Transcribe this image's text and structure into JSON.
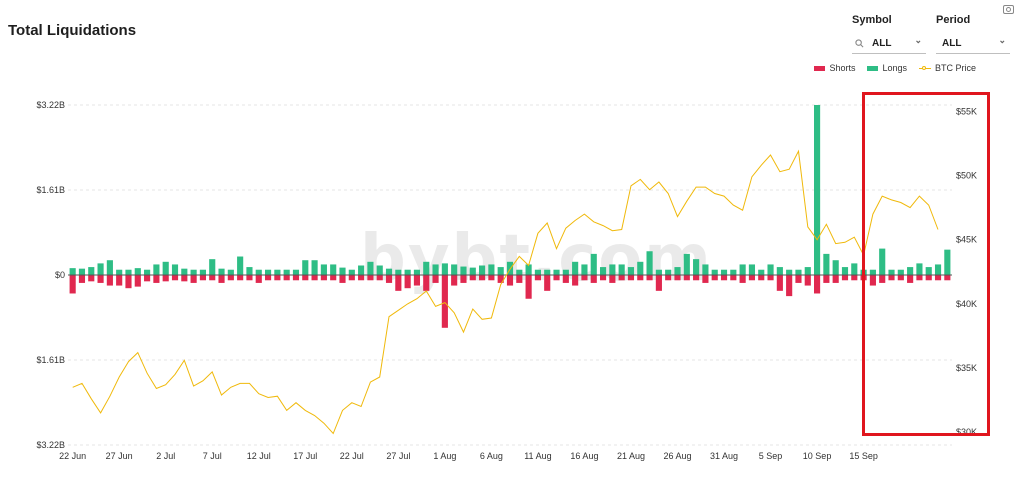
{
  "title": "Total Liquidations",
  "filters": {
    "symbol": {
      "label": "Symbol",
      "value": "ALL"
    },
    "period": {
      "label": "Period",
      "value": "ALL"
    }
  },
  "icons": {
    "search": "search-icon",
    "chevron": "chevron-down-icon",
    "camera": "camera-icon"
  },
  "watermark": "bybt.com",
  "colors": {
    "shorts": "#e0284f",
    "longs": "#2ebd85",
    "price": "#f0b90b",
    "highlight": "#e0161e"
  },
  "chart_data": {
    "type": "bar",
    "legend": {
      "position": "top-right",
      "entries": [
        "Shorts",
        "Longs",
        "BTC Price"
      ]
    },
    "grid": true,
    "left_axis": {
      "ticks": [
        "$3.22B",
        "$1.61B",
        "$0",
        "$1.61B",
        "$3.22B"
      ],
      "ylim": [
        -3.22,
        3.22
      ],
      "unit": "B"
    },
    "right_axis": {
      "ticks": [
        "$55K",
        "$50K",
        "$45K",
        "$40K",
        "$35K",
        "$30K"
      ],
      "ylim": [
        29000,
        55500
      ]
    },
    "x_labels": [
      "22 Jun",
      "27 Jun",
      "2 Jul",
      "7 Jul",
      "12 Jul",
      "17 Jul",
      "22 Jul",
      "27 Jul",
      "1 Aug",
      "6 Aug",
      "11 Aug",
      "16 Aug",
      "21 Aug",
      "26 Aug",
      "31 Aug",
      "5 Sep",
      "10 Sep",
      "15 Sep"
    ],
    "x_label_index": [
      0,
      5,
      10,
      15,
      20,
      25,
      30,
      35,
      40,
      45,
      50,
      55,
      60,
      65,
      70,
      75,
      80,
      85
    ],
    "series": [
      {
        "name": "Longs",
        "values": [
          0.13,
          0.12,
          0.15,
          0.22,
          0.28,
          0.1,
          0.1,
          0.13,
          0.1,
          0.2,
          0.25,
          0.2,
          0.12,
          0.1,
          0.1,
          0.3,
          0.12,
          0.1,
          0.35,
          0.15,
          0.1,
          0.1,
          0.1,
          0.1,
          0.1,
          0.28,
          0.28,
          0.2,
          0.2,
          0.14,
          0.1,
          0.18,
          0.25,
          0.18,
          0.12,
          0.1,
          0.1,
          0.1,
          0.25,
          0.2,
          0.22,
          0.2,
          0.16,
          0.14,
          0.18,
          0.2,
          0.15,
          0.25,
          0.1,
          0.2,
          0.1,
          0.1,
          0.1,
          0.1,
          0.25,
          0.2,
          0.4,
          0.15,
          0.2,
          0.2,
          0.15,
          0.25,
          0.45,
          0.1,
          0.1,
          0.15,
          0.4,
          0.3,
          0.2,
          0.1,
          0.1,
          0.1,
          0.2,
          0.2,
          0.1,
          0.2,
          0.15,
          0.1,
          0.1,
          0.15,
          3.22,
          0.4,
          0.28,
          0.15,
          0.22,
          0.1,
          0.1,
          0.5,
          0.1,
          0.1,
          0.15,
          0.22,
          0.15,
          0.2,
          0.48
        ]
      },
      {
        "name": "Shorts",
        "values": [
          0.35,
          0.15,
          0.12,
          0.15,
          0.2,
          0.2,
          0.25,
          0.22,
          0.12,
          0.15,
          0.12,
          0.1,
          0.12,
          0.15,
          0.1,
          0.1,
          0.15,
          0.1,
          0.1,
          0.1,
          0.15,
          0.1,
          0.1,
          0.1,
          0.1,
          0.1,
          0.1,
          0.1,
          0.1,
          0.15,
          0.1,
          0.1,
          0.1,
          0.1,
          0.15,
          0.3,
          0.25,
          0.2,
          0.3,
          0.15,
          1.0,
          0.2,
          0.15,
          0.1,
          0.1,
          0.1,
          0.15,
          0.2,
          0.15,
          0.45,
          0.1,
          0.3,
          0.1,
          0.15,
          0.2,
          0.1,
          0.15,
          0.1,
          0.15,
          0.1,
          0.1,
          0.1,
          0.1,
          0.3,
          0.1,
          0.1,
          0.1,
          0.1,
          0.15,
          0.1,
          0.1,
          0.1,
          0.15,
          0.1,
          0.1,
          0.1,
          0.3,
          0.4,
          0.15,
          0.2,
          0.35,
          0.15,
          0.15,
          0.1,
          0.1,
          0.1,
          0.2,
          0.15,
          0.1,
          0.1,
          0.15,
          0.1,
          0.1,
          0.1,
          0.1
        ]
      },
      {
        "name": "BTC Price",
        "values": [
          33500,
          33800,
          32600,
          31500,
          32800,
          34300,
          35500,
          36200,
          34600,
          33400,
          33700,
          34500,
          35600,
          33600,
          34000,
          34700,
          32900,
          33500,
          33800,
          33800,
          33000,
          32700,
          32800,
          31700,
          32300,
          31700,
          31300,
          30700,
          29900,
          31700,
          32300,
          32000,
          33900,
          34300,
          39000,
          39500,
          40000,
          40400,
          41000,
          39800,
          40100,
          39300,
          37800,
          39600,
          38800,
          38900,
          41500,
          42700,
          43700,
          43000,
          45500,
          46300,
          44300,
          45900,
          46500,
          47000,
          46400,
          46100,
          45700,
          45800,
          49200,
          49700,
          48900,
          49500,
          48600,
          46800,
          48000,
          49100,
          49100,
          48600,
          48400,
          47700,
          47300,
          49900,
          50800,
          51600,
          50300,
          50500,
          51900,
          46000,
          45000,
          46200,
          44700,
          44800,
          45200,
          43800,
          47000,
          48400,
          48100,
          47900,
          47500,
          48400,
          47700,
          45800
        ]
      }
    ]
  }
}
